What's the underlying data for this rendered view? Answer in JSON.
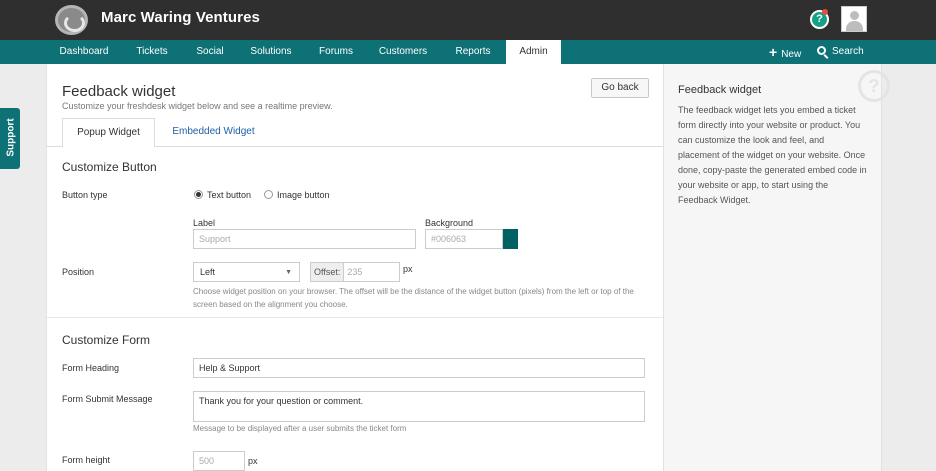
{
  "topbar": {
    "brand": "Marc Waring Ventures",
    "help_icon": "question-circle-icon",
    "avatar_icon": "user-avatar-icon",
    "accent_color": "#0d7176"
  },
  "nav": {
    "items": [
      "Dashboard",
      "Tickets",
      "Social",
      "Solutions",
      "Forums",
      "Customers",
      "Reports",
      "Admin"
    ],
    "active": "Admin",
    "new_label": "New",
    "search_label": "Search"
  },
  "support_tab": {
    "label": "Support"
  },
  "page": {
    "title": "Feedback widget",
    "subtitle": "Customize your freshdesk widget below and see a realtime preview.",
    "go_back": "Go back",
    "tabs": [
      "Popup Widget",
      "Embedded Widget"
    ],
    "active_tab": "Popup Widget"
  },
  "customize_button": {
    "title": "Customize Button",
    "button_type_label": "Button type",
    "options": [
      "Text button",
      "Image button"
    ],
    "selected_option": "Text button",
    "label_label": "Label",
    "label_placeholder": "Support",
    "background_label": "Background",
    "background_value": "#006063",
    "position_label": "Position",
    "position_value": "Left",
    "offset_addon": "Offset:",
    "offset_placeholder": "235",
    "offset_unit": "px",
    "position_help": "Choose widget position on your browser. The offset will be the distance of the widget button (pixels) from the left or top of the screen based on the alignment you choose."
  },
  "customize_form": {
    "title": "Customize Form",
    "heading_label": "Form Heading",
    "heading_value": "Help & Support",
    "submit_label": "Form Submit Message",
    "submit_value": "Thank you for your question or comment.",
    "submit_help": "Message to be displayed after a user submits the ticket form",
    "height_label": "Form height",
    "height_placeholder": "500",
    "height_unit": "px"
  },
  "sidebar": {
    "title": "Feedback widget",
    "text": "The feedback widget lets you embed a ticket form directly into your website or product. You can customize the look and feel, and placement of the widget on your website. Once done, copy-paste the generated embed code in your website or app, to start using the Feedback Widget."
  }
}
